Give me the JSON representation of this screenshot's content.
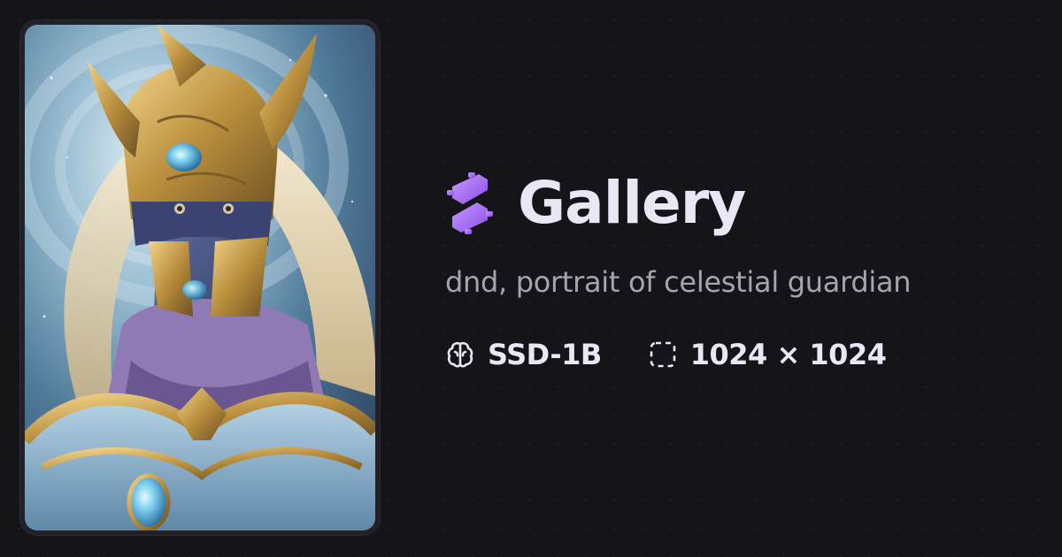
{
  "page": {
    "title": "Gallery",
    "prompt": "dnd, portrait of celestial guardian"
  },
  "image": {
    "description_icon": "celestial-guardian-portrait"
  },
  "meta": {
    "model_icon": "brain-icon",
    "model": "SSD-1B",
    "size_icon": "dashed-frame-icon",
    "size": "1024 × 1024"
  },
  "colors": {
    "background": "#151419",
    "accent": "#a76bf5",
    "title": "#e9e7f4",
    "prompt": "#a6a4af"
  }
}
